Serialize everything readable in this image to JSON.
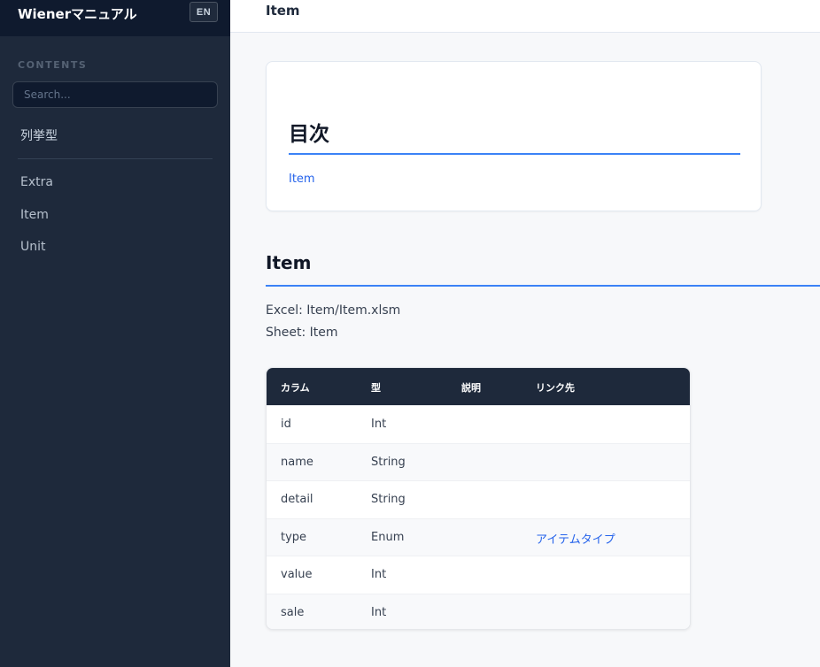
{
  "sidebar": {
    "app_title": "Wienerマニュアル",
    "lang_button": "EN",
    "contents_label": "CONTENTS",
    "search_placeholder": "Search...",
    "group_label": "列挙型",
    "items": [
      {
        "label": "Extra"
      },
      {
        "label": "Item"
      },
      {
        "label": "Unit"
      }
    ]
  },
  "topbar": {
    "title": "Item"
  },
  "toc": {
    "title": "目次",
    "links": [
      {
        "label": "Item"
      }
    ]
  },
  "section": {
    "title": "Item",
    "excel_line": "Excel: Item/Item.xlsm",
    "sheet_line": "Sheet: Item"
  },
  "table": {
    "headers": [
      "カラム",
      "型",
      "説明",
      "リンク先"
    ],
    "rows": [
      {
        "column": "id",
        "type": "Int",
        "desc": "",
        "link": ""
      },
      {
        "column": "name",
        "type": "String",
        "desc": "",
        "link": ""
      },
      {
        "column": "detail",
        "type": "String",
        "desc": "",
        "link": ""
      },
      {
        "column": "type",
        "type": "Enum",
        "desc": "",
        "link": "アイテムタイプ"
      },
      {
        "column": "value",
        "type": "Int",
        "desc": "",
        "link": ""
      },
      {
        "column": "sale",
        "type": "Int",
        "desc": "",
        "link": ""
      }
    ]
  },
  "colors": {
    "sidebar_bg": "#1e293b",
    "accent": "#3b82f6",
    "link": "#2563eb"
  }
}
